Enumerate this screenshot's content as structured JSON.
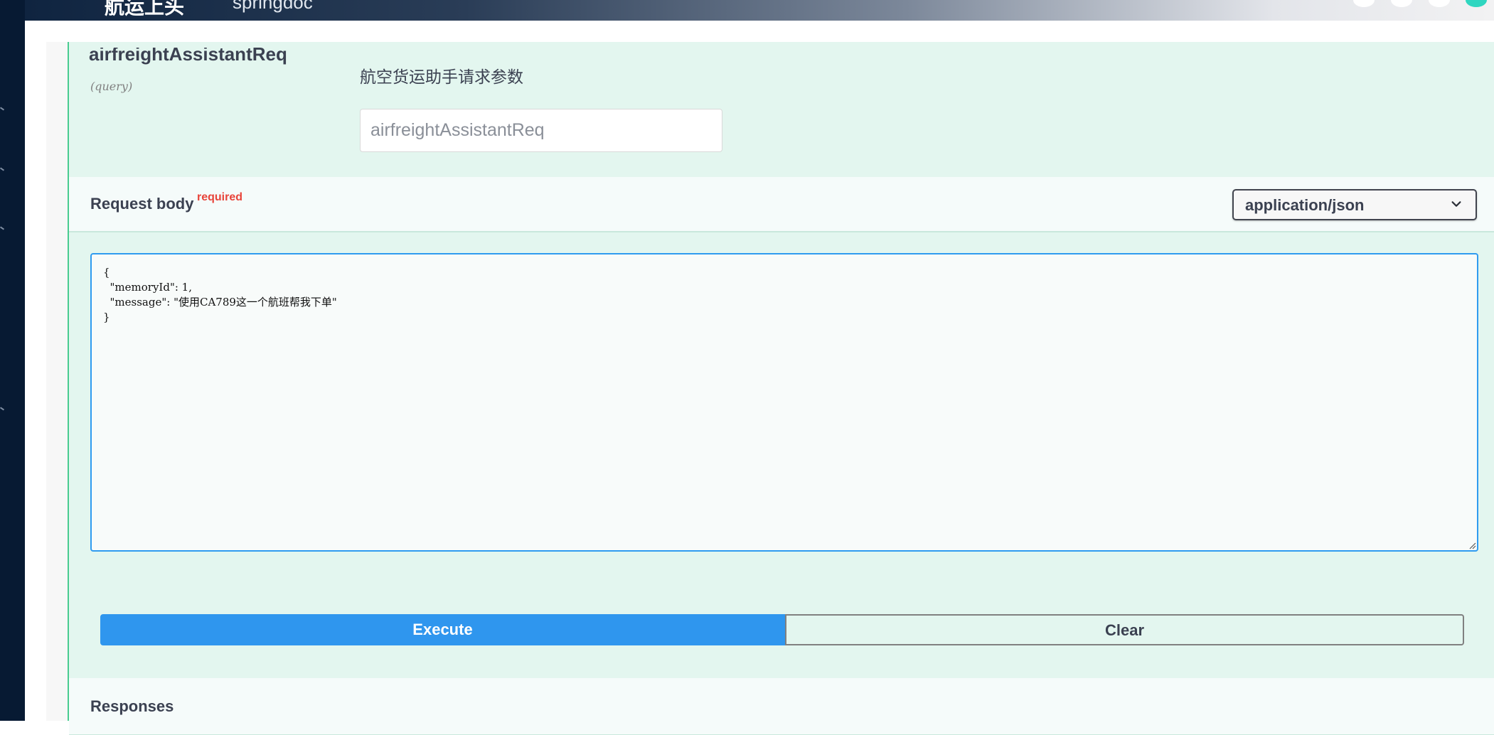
{
  "header": {
    "brand": "航运上头",
    "product": "springdoc"
  },
  "parameter": {
    "name": "airfreightAssistantReq",
    "in": "(query)",
    "description": "航空货运助手请求参数",
    "placeholder": "airfreightAssistantReq"
  },
  "request_body": {
    "title": "Request body",
    "required_label": "required",
    "content_type": "application/json",
    "value": "{\n  \"memoryId\": 1,\n  \"message\": \"使用CA789这一个航班帮我下单\"\n}"
  },
  "actions": {
    "execute_label": "Execute",
    "clear_label": "Clear"
  },
  "responses": {
    "title": "Responses"
  }
}
